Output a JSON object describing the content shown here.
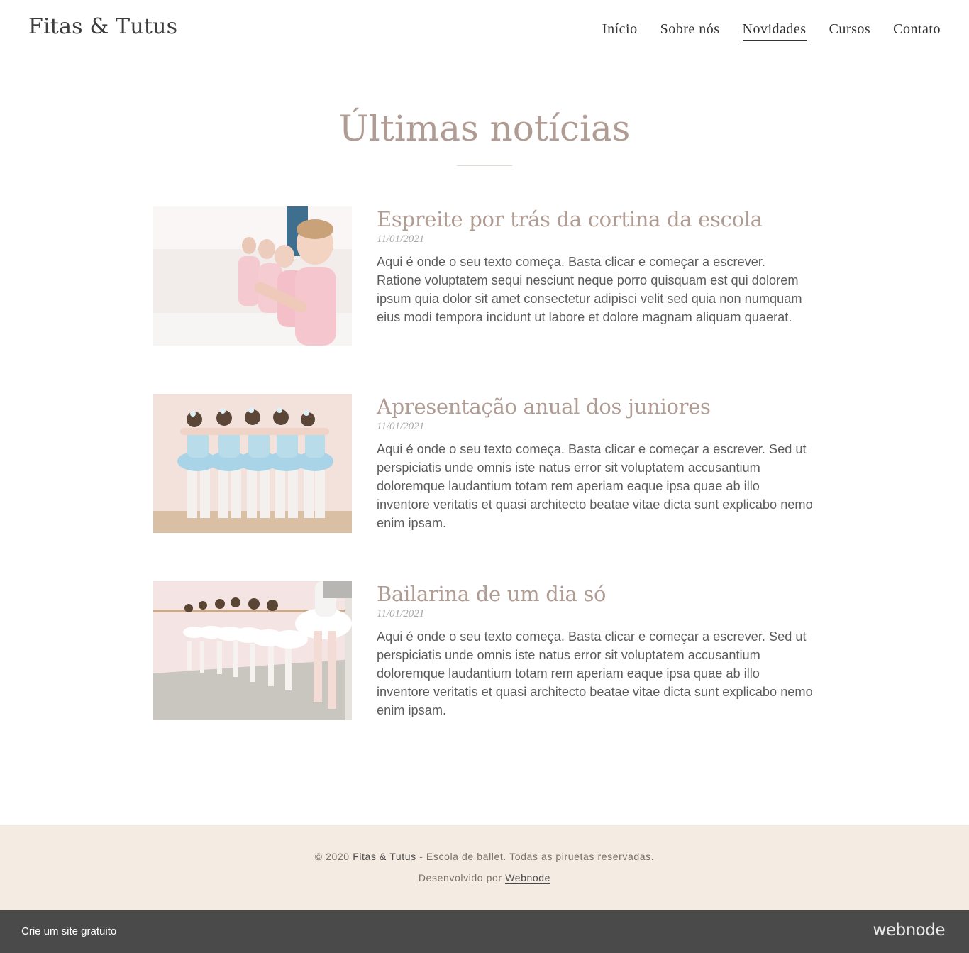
{
  "header": {
    "logo": "Fitas & Tutus",
    "nav": [
      {
        "label": "Início"
      },
      {
        "label": "Sobre nós"
      },
      {
        "label": "Novidades",
        "active": true
      },
      {
        "label": "Cursos"
      },
      {
        "label": "Contato"
      }
    ]
  },
  "main": {
    "title": "Últimas notícias",
    "articles": [
      {
        "title": "Espreite por trás da cortina da escola",
        "date": "11/01/2021",
        "text": "Aqui é onde o seu texto começa. Basta clicar e começar a escrever. Ratione voluptatem sequi nesciunt neque porro quisquam est qui dolorem ipsum quia dolor sit amet consectetur adipisci velit sed quia non numquam eius modi tempora incidunt ut labore et dolore magnam aliquam quaerat."
      },
      {
        "title": "Apresentação anual dos juniores",
        "date": "11/01/2021",
        "text": "Aqui é onde o seu texto começa. Basta clicar e começar a escrever. Sed ut perspiciatis unde omnis iste natus error sit voluptatem accusantium doloremque laudantium totam rem aperiam eaque ipsa quae ab illo inventore veritatis et quasi architecto beatae vitae dicta sunt explicabo nemo enim ipsam."
      },
      {
        "title": "Bailarina de um dia só",
        "date": "11/01/2021",
        "text": "Aqui é onde o seu texto começa. Basta clicar e começar a escrever. Sed ut perspiciatis unde omnis iste natus error sit voluptatem accusantium doloremque laudantium totam rem aperiam eaque ipsa quae ab illo inventore veritatis et quasi architecto beatae vitae dicta sunt explicabo nemo enim ipsam."
      }
    ]
  },
  "footer": {
    "copyright_prefix": "© 2020 ",
    "brand": "Fitas & Tutus",
    "copyright_suffix": " - Escola de ballet. Todas as piruetas reservadas.",
    "developed_by": "Desenvolvido por ",
    "webnode_link": "Webnode"
  },
  "promo_bar": {
    "cta": "Crie um site gratuito",
    "brand": "webnode"
  },
  "colors": {
    "accent_title": "#b09c93",
    "footer_bg": "#f4ebe2",
    "bar_bg": "#4a4a4a"
  }
}
